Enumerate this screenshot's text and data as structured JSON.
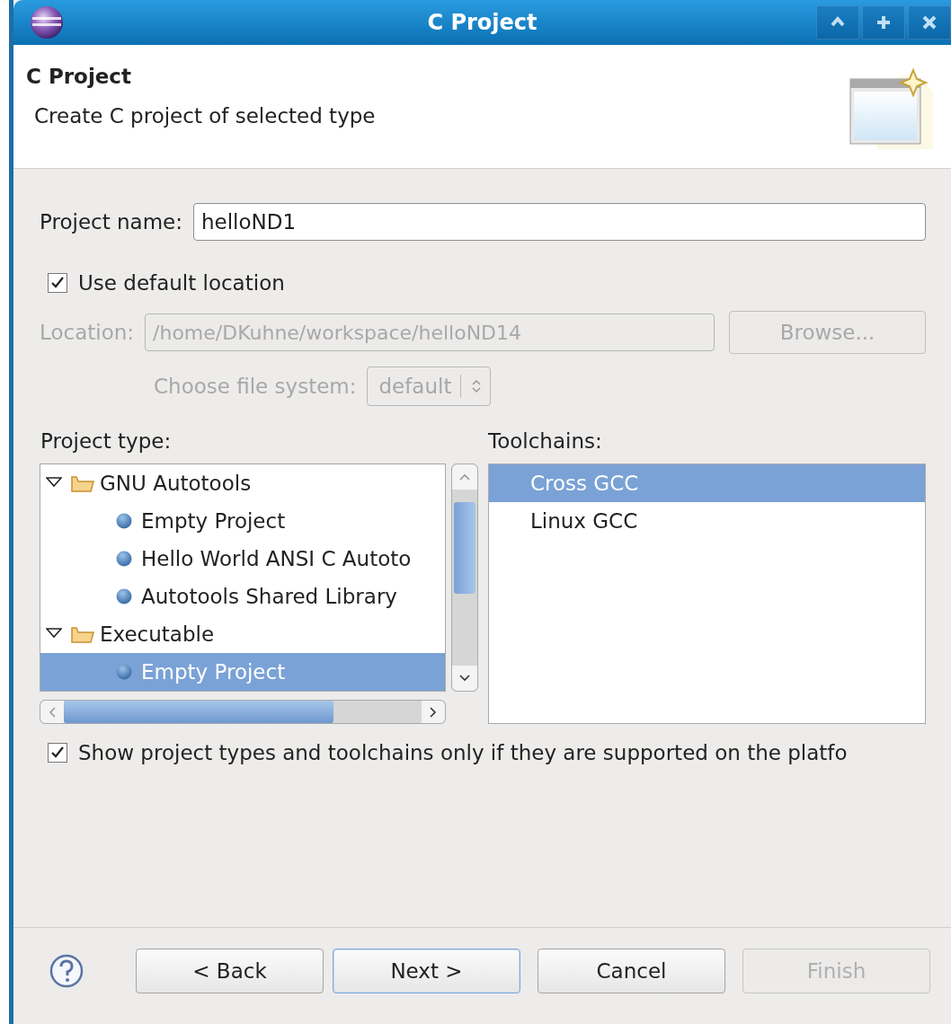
{
  "window": {
    "title": "C Project"
  },
  "header": {
    "heading": "C Project",
    "description": "Create C project of selected type"
  },
  "project_name": {
    "label": "Project name:",
    "value": "helloND1"
  },
  "use_default_location": {
    "label": "Use default location",
    "checked": true
  },
  "location": {
    "label": "Location:",
    "value": "/home/DKuhne/workspace/helloND14",
    "disabled": true,
    "browse": "Browse..."
  },
  "file_system": {
    "label": "Choose file system:",
    "value": "default",
    "disabled": true
  },
  "project_type": {
    "label": "Project type:",
    "items": [
      {
        "label": "GNU Autotools",
        "expanded": true,
        "selected": false,
        "children": [
          {
            "label": "Empty Project",
            "selected": false
          },
          {
            "label": "Hello World ANSI C Autoto",
            "selected": false
          },
          {
            "label": "Autotools Shared Library",
            "selected": false
          }
        ]
      },
      {
        "label": "Executable",
        "expanded": true,
        "selected": false,
        "children": [
          {
            "label": "Empty Project",
            "selected": true
          }
        ]
      }
    ]
  },
  "toolchains": {
    "label": "Toolchains:",
    "items": [
      {
        "label": "Cross GCC",
        "selected": true
      },
      {
        "label": "Linux GCC",
        "selected": false
      }
    ]
  },
  "show_supported": {
    "label": "Show project types and toolchains only if they are supported on the platfo",
    "checked": true
  },
  "buttons": [
    {
      "label": "< Back",
      "disabled": false,
      "focused": false
    },
    {
      "label": "Next >",
      "disabled": false,
      "focused": true
    },
    {
      "label": "Cancel",
      "disabled": false,
      "focused": false
    },
    {
      "label": "Finish",
      "disabled": true,
      "focused": false
    }
  ]
}
